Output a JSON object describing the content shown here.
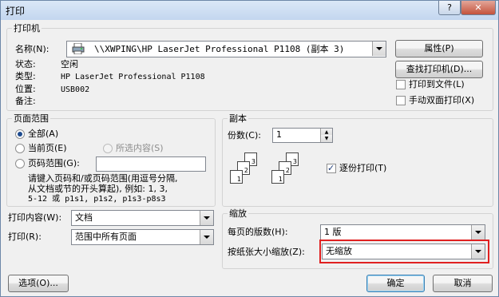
{
  "window": {
    "title": "打印",
    "help_label": "?",
    "close_label": "✕"
  },
  "printer": {
    "group_label": "打印机",
    "name_label": "名称(N):",
    "name_value": "\\\\XWPING\\HP LaserJet Professional P1108 (副本 3)",
    "status_label": "状态:",
    "status_value": "空闲",
    "type_label": "类型:",
    "type_value": "HP LaserJet Professional P1108",
    "location_label": "位置:",
    "location_value": "USB002",
    "comment_label": "备注:",
    "comment_value": "",
    "properties_button": "属性(P)",
    "find_button": "查找打印机(D)...",
    "print_to_file": {
      "label": "打印到文件(L)",
      "checked": false
    },
    "manual_duplex": {
      "label": "手动双面打印(X)",
      "checked": false
    }
  },
  "page_range": {
    "group_label": "页面范围",
    "all": {
      "label": "全部(A)",
      "checked": true
    },
    "current": {
      "label": "当前页(E)",
      "checked": false
    },
    "selection": {
      "label": "所选内容(S)",
      "checked": false
    },
    "pages": {
      "label": "页码范围(G):",
      "checked": false,
      "value": ""
    },
    "help_lines": [
      "请键入页码和/或页码范围(用逗号分隔,",
      "从文档或节的开头算起), 例如: 1, 3,",
      "5-12 或 p1s1, p1s2, p1s3-p8s3"
    ]
  },
  "copies": {
    "group_label": "副本",
    "count_label": "份数(C):",
    "count_value": "1",
    "collate": {
      "label": "逐份打印(T)",
      "checked": true
    },
    "stack_a_pages": [
      "3",
      "2",
      "1"
    ],
    "stack_b_pages": [
      "3",
      "2",
      "1"
    ]
  },
  "print_what": {
    "label": "打印内容(W):",
    "value": "文档"
  },
  "print_range": {
    "label": "打印(R):",
    "value": "范围中所有页面"
  },
  "zoom": {
    "group_label": "缩放",
    "pages_per_sheet_label": "每页的版数(H):",
    "pages_per_sheet_value": "1 版",
    "scale_label": "按纸张大小缩放(Z):",
    "scale_value": "无缩放"
  },
  "footer": {
    "options_button": "选项(O)...",
    "ok_button": "确定",
    "cancel_button": "取消"
  },
  "highlight_color": "#e02020"
}
